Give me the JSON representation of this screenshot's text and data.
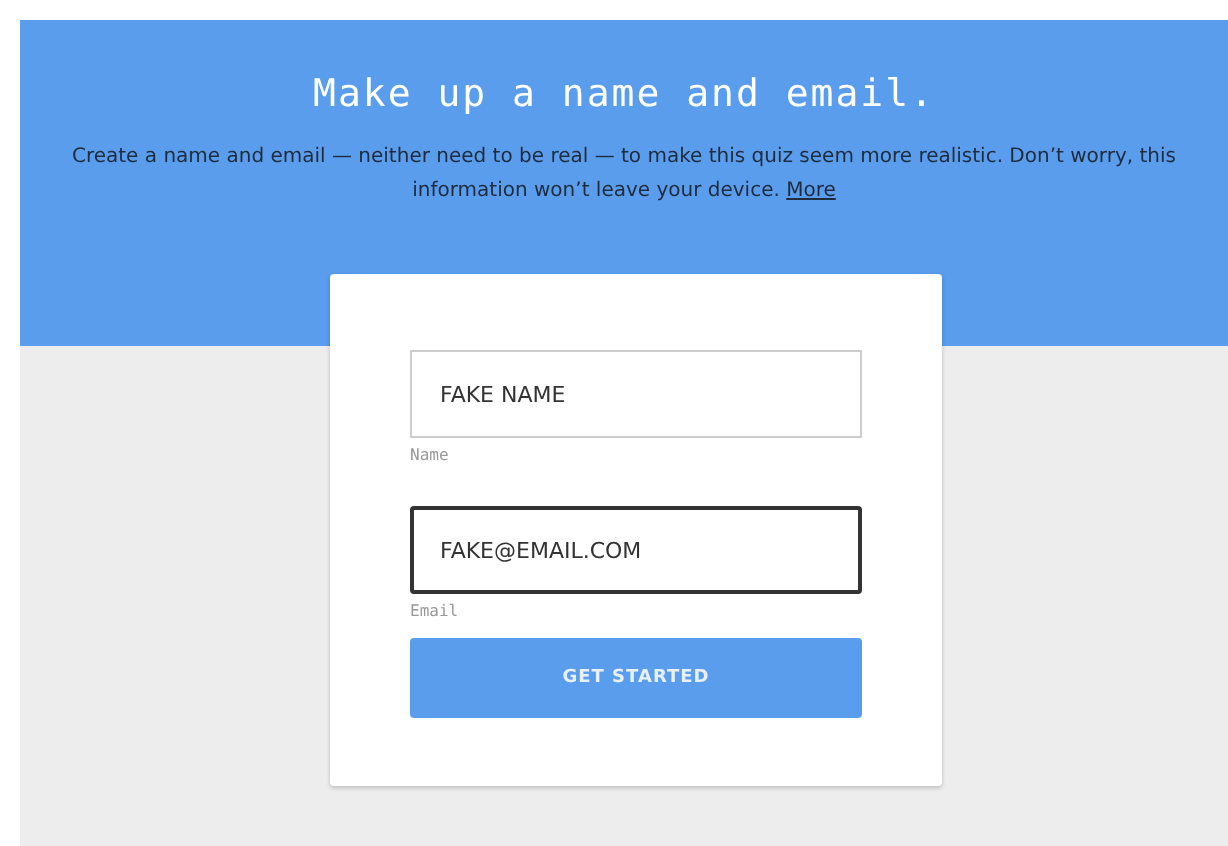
{
  "header": {
    "title": "Make up a name and email.",
    "description": "Create a name and email — neither need to be real — to make this quiz seem more realistic. Don’t worry, this information won’t leave your device.",
    "more_link": "More"
  },
  "form": {
    "fields": [
      {
        "value": "FAKE NAME",
        "label": "Name",
        "focused": false
      },
      {
        "value": "FAKE@EMAIL.COM",
        "label": "Email",
        "focused": true
      }
    ],
    "submit_button": "GET STARTED"
  }
}
